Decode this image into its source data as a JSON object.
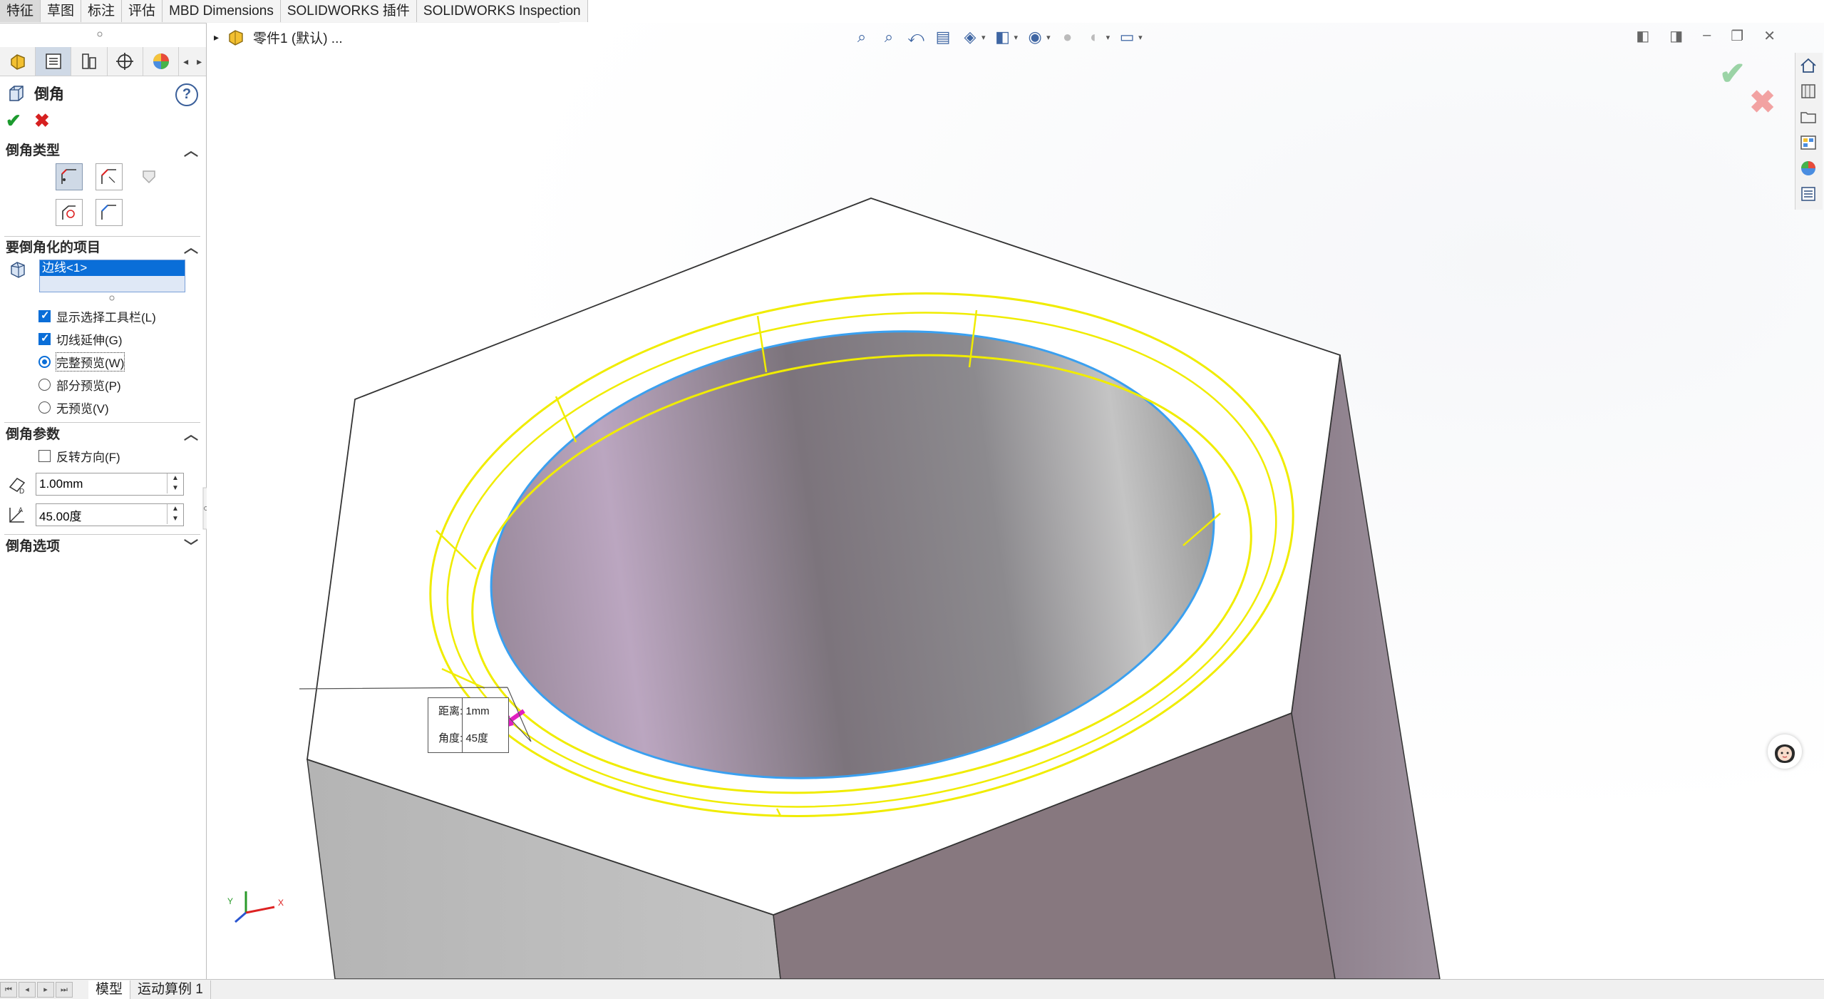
{
  "command_tabs": [
    "特征",
    "草图",
    "标注",
    "评估",
    "MBD Dimensions",
    "SOLIDWORKS 插件",
    "SOLIDWORKS Inspection"
  ],
  "feature_manager_tree": {
    "root_label": "零件1 (默认) ..."
  },
  "property_manager": {
    "title": "倒角",
    "help": "?",
    "chamfer_type": {
      "header": "倒角类型"
    },
    "items_to_chamfer": {
      "header": "要倒角化的项目",
      "selection": "边线<1>"
    },
    "options": [
      {
        "label": "显示选择工具栏(L)",
        "kind": "checkbox",
        "checked": true
      },
      {
        "label": "切线延伸(G)",
        "kind": "checkbox",
        "checked": true
      },
      {
        "label": "完整预览(W)",
        "kind": "radio",
        "checked": true
      },
      {
        "label": "部分预览(P)",
        "kind": "radio",
        "checked": false
      },
      {
        "label": "无预览(V)",
        "kind": "radio",
        "checked": false
      }
    ],
    "chamfer_params": {
      "header": "倒角参数",
      "reverse_label": "反转方向(F)",
      "distance": "1.00mm",
      "angle": "45.00度"
    },
    "chamfer_options": {
      "header": "倒角选项"
    }
  },
  "callout": {
    "distance": "距离: 1mm",
    "angle": "角度: 45度"
  },
  "bottom_tabs": [
    "模型",
    "运动算例 1"
  ],
  "colors": {
    "accent": "#0a6ed8",
    "preview": "#f5f000",
    "edge_highlight": "#3aa0f0"
  }
}
